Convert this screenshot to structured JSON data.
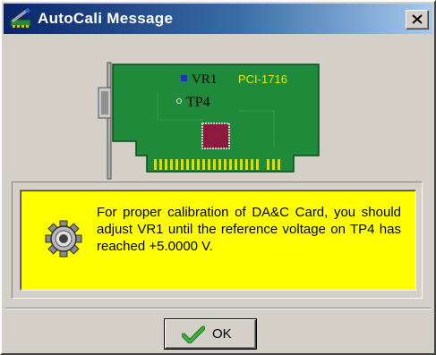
{
  "window": {
    "title": "AutoCali Message",
    "close_symbol": "✕",
    "app_icon": "calibration-tool-icon"
  },
  "card": {
    "model_label": "PCI-1716",
    "vr_label": "VR1",
    "tp_label": "TP4"
  },
  "message": {
    "icon": "gear-icon",
    "text": "For proper calibration of DA&C Card, you should adjust VR1 until the reference voltage on TP4 has reached  +5.0000 V."
  },
  "buttons": {
    "ok_label": "OK"
  },
  "colors": {
    "titlebar_start": "#0a246a",
    "titlebar_end": "#a6caf0",
    "panel_background": "#ffff00",
    "pcb_green": "#1f8a3a",
    "model_label_color": "#e8e800",
    "check_green": "#2f9a2f"
  }
}
